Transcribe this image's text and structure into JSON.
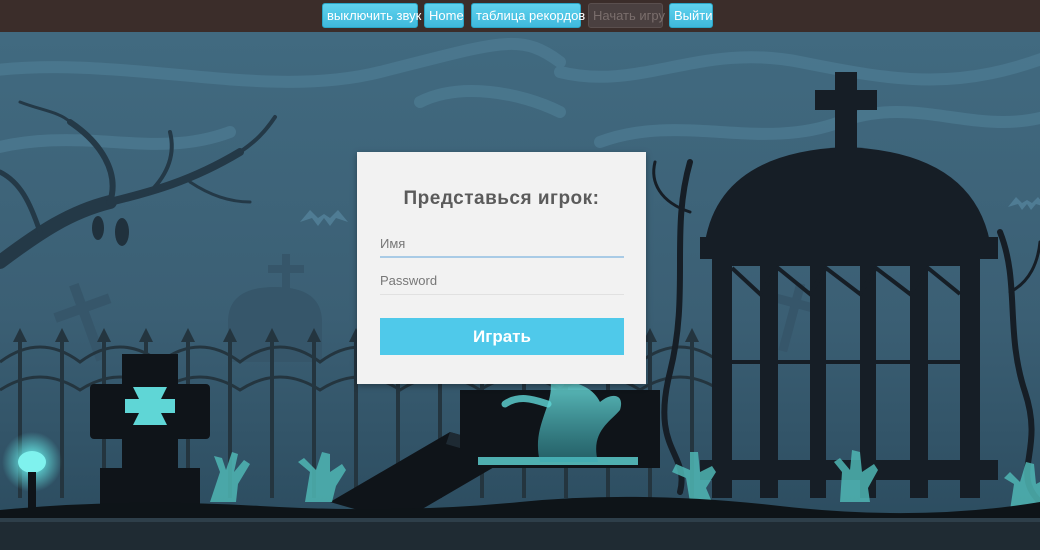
{
  "nav": {
    "buttons": [
      {
        "label": "выключить звук",
        "enabled": true
      },
      {
        "label": "Home",
        "enabled": true
      },
      {
        "label": "таблица рекордов",
        "enabled": true
      },
      {
        "label": "Начать игру",
        "enabled": false
      },
      {
        "label": "Выйти",
        "enabled": true
      }
    ]
  },
  "login": {
    "title": "Представься игрок:",
    "name_placeholder": "Имя",
    "password_placeholder": "Password",
    "play_label": "Играть"
  },
  "colors": {
    "topbar": "#3b2d2a",
    "accent": "#4fc9ea",
    "sky": "#3e6176",
    "silhouette": "#111a22",
    "glow": "#5fd6d6"
  }
}
